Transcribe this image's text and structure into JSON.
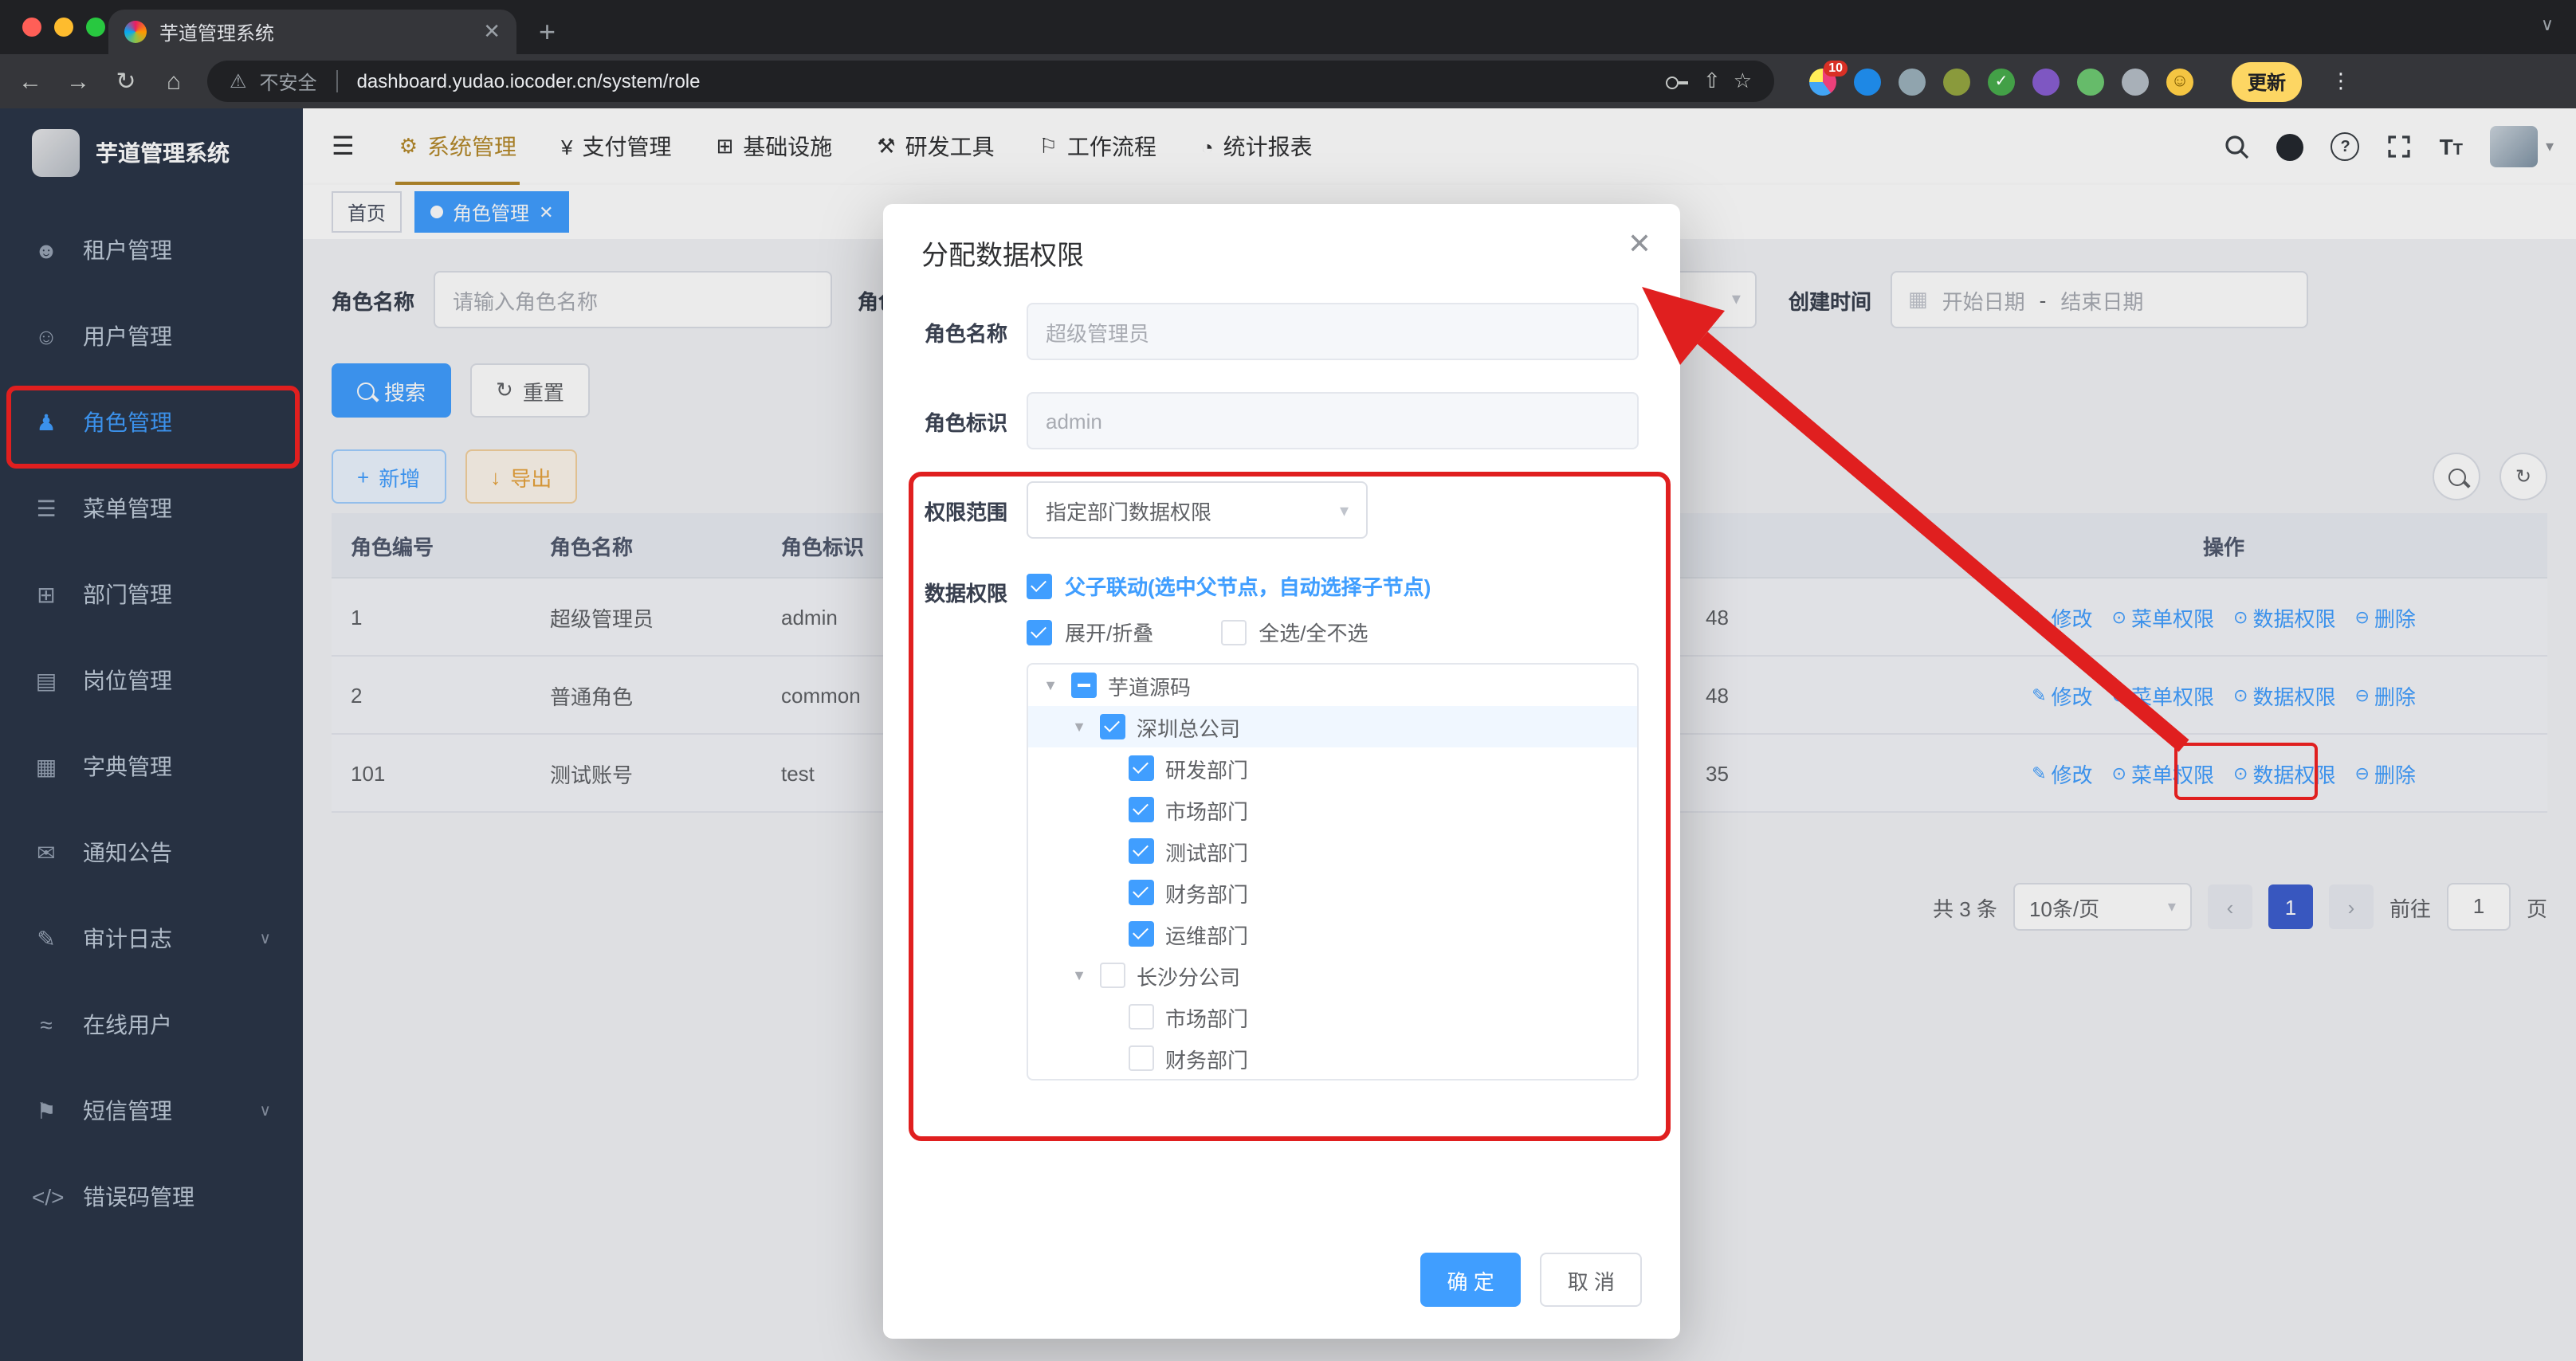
{
  "browser": {
    "tab_title": "芋道管理系统",
    "security_label": "不安全",
    "url": "dashboard.yudao.iocoder.cn/system/role",
    "extension_badge": "10",
    "update_label": "更新"
  },
  "sidebar": {
    "app_title": "芋道管理系统",
    "items": [
      {
        "label": "租户管理",
        "icon": "tenant-icon"
      },
      {
        "label": "用户管理",
        "icon": "user-icon"
      },
      {
        "label": "角色管理",
        "icon": "role-icon"
      },
      {
        "label": "菜单管理",
        "icon": "menu-icon"
      },
      {
        "label": "部门管理",
        "icon": "dept-icon"
      },
      {
        "label": "岗位管理",
        "icon": "post-icon"
      },
      {
        "label": "字典管理",
        "icon": "dict-icon"
      },
      {
        "label": "通知公告",
        "icon": "notice-icon"
      },
      {
        "label": "审计日志",
        "icon": "audit-log-icon"
      },
      {
        "label": "在线用户",
        "icon": "online-user-icon"
      },
      {
        "label": "短信管理",
        "icon": "sms-icon"
      },
      {
        "label": "错误码管理",
        "icon": "error-code-icon"
      }
    ]
  },
  "topnav": {
    "menus": [
      {
        "label": "系统管理"
      },
      {
        "label": "支付管理"
      },
      {
        "label": "基础设施"
      },
      {
        "label": "研发工具"
      },
      {
        "label": "工作流程"
      },
      {
        "label": "统计报表"
      }
    ]
  },
  "tags": {
    "home": "首页",
    "active": "角色管理"
  },
  "filter": {
    "role_name_label": "角色名称",
    "role_name_placeholder": "请输入角色名称",
    "partial_label": "角色",
    "create_time_label": "创建时间",
    "start_placeholder": "开始日期",
    "separator": "-",
    "end_placeholder": "结束日期",
    "search_label": "搜索",
    "reset_label": "重置",
    "add_label": "新增",
    "export_label": "导出"
  },
  "table": {
    "col_id": "角色编号",
    "col_name": "角色名称",
    "col_key": "角色标识",
    "col_actions": "操作",
    "rows": [
      {
        "id": "1",
        "name": "超级管理员",
        "key": "admin",
        "time": "48"
      },
      {
        "id": "2",
        "name": "普通角色",
        "key": "common",
        "time": "48"
      },
      {
        "id": "101",
        "name": "测试账号",
        "key": "test",
        "time": "35"
      }
    ],
    "action_edit": "修改",
    "action_menu_perm": "菜单权限",
    "action_data_perm": "数据权限",
    "action_delete": "删除"
  },
  "pagination": {
    "total": "共 3 条",
    "page_size": "10条/页",
    "current_page": "1",
    "goto_label": "前往",
    "goto_value": "1",
    "page_unit": "页"
  },
  "dialog": {
    "title": "分配数据权限",
    "role_name_label": "角色名称",
    "role_name_value": "超级管理员",
    "role_key_label": "角色标识",
    "role_key_value": "admin",
    "scope_label": "权限范围",
    "scope_value": "指定部门数据权限",
    "data_perm_label": "数据权限",
    "linkage_label": "父子联动(选中父节点，自动选择子节点)",
    "expand_label": "展开/折叠",
    "select_all_label": "全选/全不选",
    "confirm_label": "确 定",
    "cancel_label": "取 消",
    "tree": [
      {
        "label": "芋道源码",
        "state": "indeterminate"
      },
      {
        "label": "深圳总公司",
        "state": "checked"
      },
      {
        "label": "研发部门",
        "state": "checked"
      },
      {
        "label": "市场部门",
        "state": "checked"
      },
      {
        "label": "测试部门",
        "state": "checked"
      },
      {
        "label": "财务部门",
        "state": "checked"
      },
      {
        "label": "运维部门",
        "state": "checked"
      },
      {
        "label": "长沙分公司",
        "state": "unchecked"
      },
      {
        "label": "市场部门",
        "state": "unchecked"
      },
      {
        "label": "财务部门",
        "state": "unchecked"
      }
    ]
  },
  "colors": {
    "primary": "#409eff",
    "annotation": "#e01f1f",
    "topnav_active": "#b5892b"
  }
}
